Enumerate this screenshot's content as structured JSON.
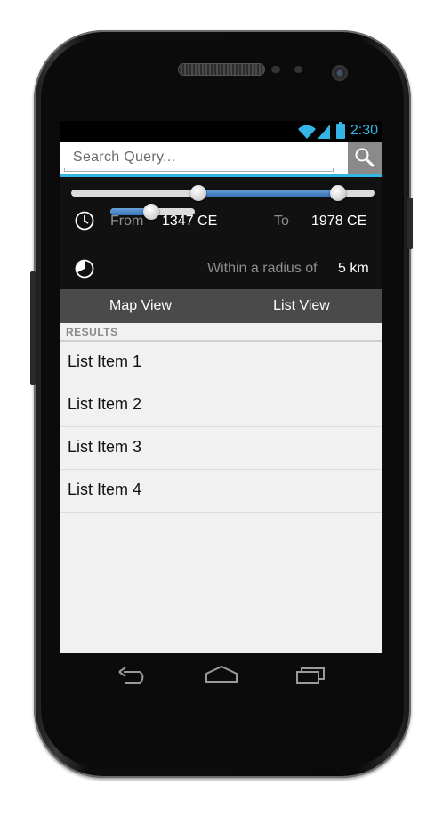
{
  "status_bar": {
    "time": "2:30"
  },
  "search": {
    "placeholder": "Search Query..."
  },
  "filters": {
    "from_label": "From",
    "from_value": "1347 CE",
    "to_label": "To",
    "to_value": "1978 CE",
    "radius_label": "Within a radius of",
    "radius_value": "5 km",
    "range_slider": {
      "low_fraction": 0.42,
      "high_fraction": 0.88
    },
    "radius_slider": {
      "fraction": 0.48
    }
  },
  "tabs": [
    {
      "label": "Map View"
    },
    {
      "label": "List View"
    }
  ],
  "results": {
    "header": "RESULTS",
    "items": [
      {
        "label": "List Item 1"
      },
      {
        "label": "List Item 2"
      },
      {
        "label": "List Item 3"
      },
      {
        "label": "List Item 4"
      }
    ]
  },
  "icons": {
    "search": "search-icon",
    "clock": "clock-icon",
    "radius": "pie-icon",
    "back": "back-icon",
    "home": "home-icon",
    "recents": "recent-apps-icon"
  },
  "colors": {
    "accent": "#33b5e5",
    "slider_fill": "#3672b8",
    "tab_bar": "#4a4a4a",
    "list_bg": "#f1f1f1"
  }
}
